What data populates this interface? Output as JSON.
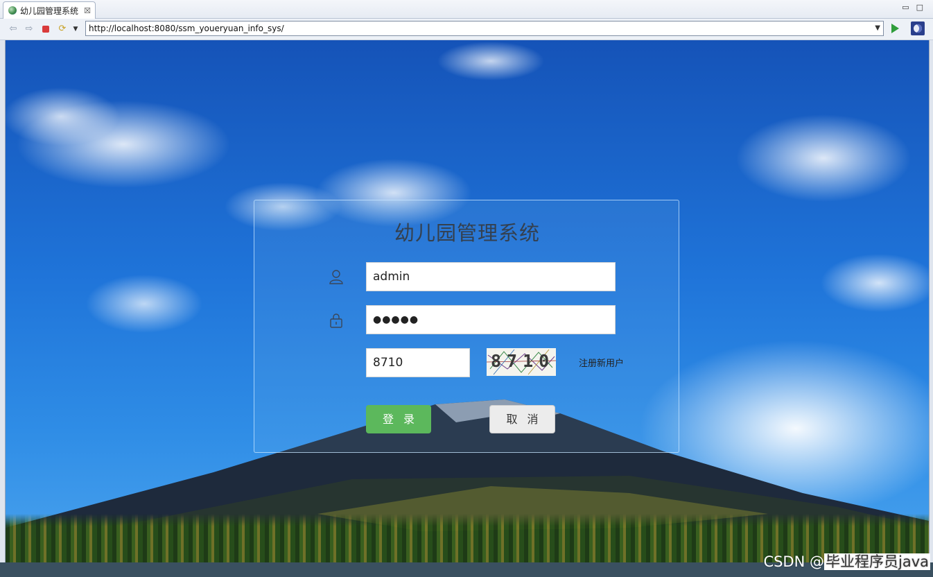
{
  "browser": {
    "tab_title": "幼儿园管理系统",
    "tab_close": "☒",
    "url": "http://localhost:8080/ssm_youeryuan_info_sys/",
    "window_controls": {
      "minimize": "▭",
      "maximize": "□"
    }
  },
  "login": {
    "title": "幼儿园管理系统",
    "username_value": "admin",
    "password_value": "●●●●●",
    "captcha_input_value": "8710",
    "captcha_image_text": "8710",
    "register_link": "注册新用户",
    "login_button": "登录",
    "cancel_button": "取消"
  },
  "watermark": {
    "prefix": "CSDN @",
    "author": "毕业程序员java"
  },
  "colors": {
    "login_button": "#5cb85c",
    "cancel_button": "#ececec",
    "sky": "#1f74d9"
  }
}
